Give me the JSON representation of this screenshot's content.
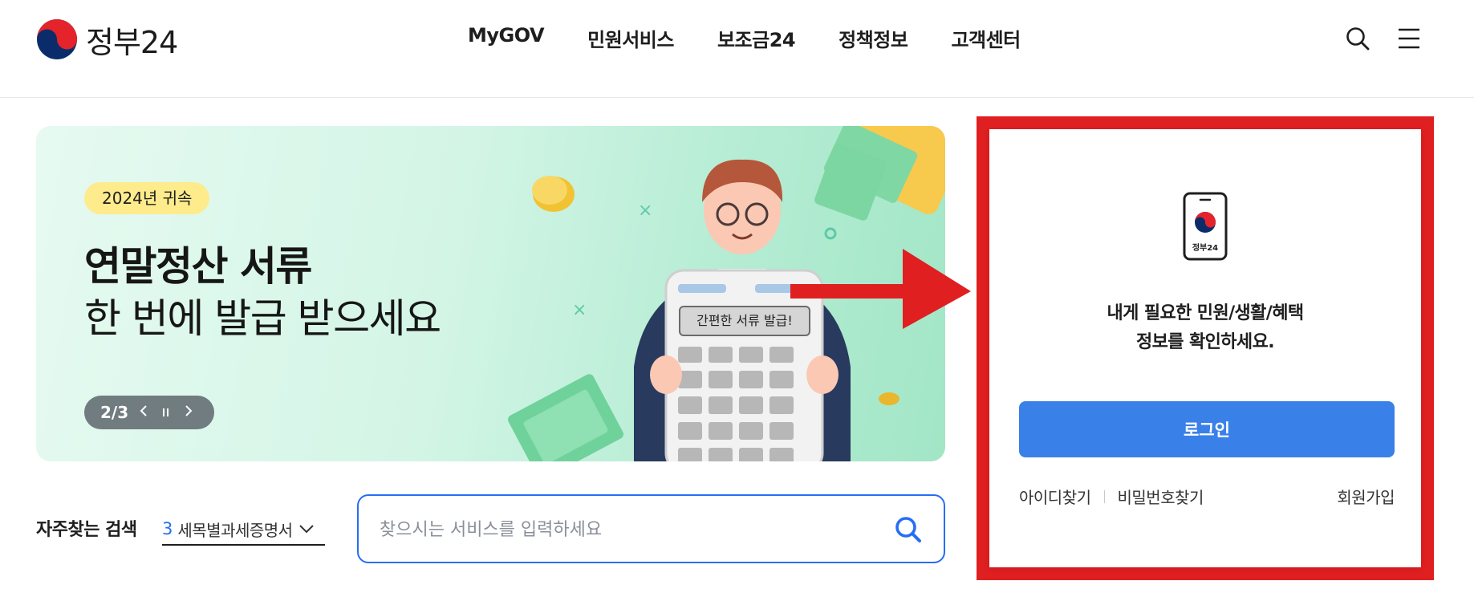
{
  "header": {
    "logo_text": "정부24",
    "nav": [
      "MyGOV",
      "민원서비스",
      "보조금24",
      "정책정보",
      "고객센터"
    ],
    "icons": {
      "search": "search-icon",
      "menu": "hamburger-menu-icon"
    }
  },
  "banner": {
    "badge": "2024년 귀속",
    "title": "연말정산 서류",
    "subtitle": "한 번에 발급 받으세요",
    "calculator_label": "간편한 서류 발급!",
    "pager": {
      "current": "2",
      "total": "3",
      "text": "2/3"
    }
  },
  "search": {
    "freq_label": "자주찾는 검색",
    "freq_rank": "3",
    "freq_term": "세목별과세증명서",
    "placeholder": "찾으시는 서비스를 입력하세요"
  },
  "login": {
    "phone_icon_label": "정부24",
    "message_line1": "내게 필요한 민원/생활/혜택",
    "message_line2": "정보를 확인하세요.",
    "login_button": "로그인",
    "find_id": "아이디찾기",
    "find_password": "비밀번호찾기",
    "join": "회원가입"
  },
  "colors": {
    "accent_blue": "#256ef4",
    "login_button": "#3a80e9",
    "highlight_red": "#e01f21",
    "badge_yellow": "#fdeb8c"
  }
}
